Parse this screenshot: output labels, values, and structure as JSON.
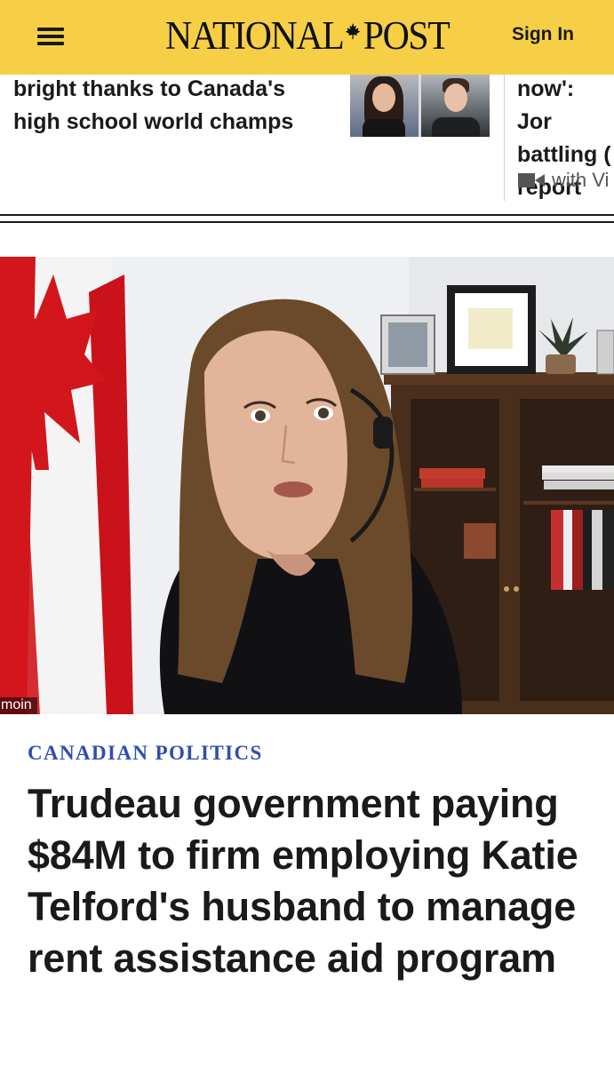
{
  "header": {
    "logo_left": "NATIONAL",
    "logo_right": "POST",
    "signin_label": "Sign In",
    "background": "#f6cf47"
  },
  "related": [
    {
      "text": "bright thanks to Canada's high school world champs"
    },
    {
      "text": "now': Jor battling ( report",
      "tag": "with Vi"
    }
  ],
  "hero": {
    "caption": "moin"
  },
  "article": {
    "section": "CANADIAN POLITICS",
    "headline": "Trudeau government paying $84M to firm employing Katie Telford's husband to manage rent assistance aid program"
  },
  "colors": {
    "accent": "#2f4fae",
    "flag_red": "#d2161c"
  },
  "icons": {
    "menu": "hamburger-menu-icon",
    "video": "video-camera-icon",
    "logo_mark": "maple-leaf-icon"
  }
}
